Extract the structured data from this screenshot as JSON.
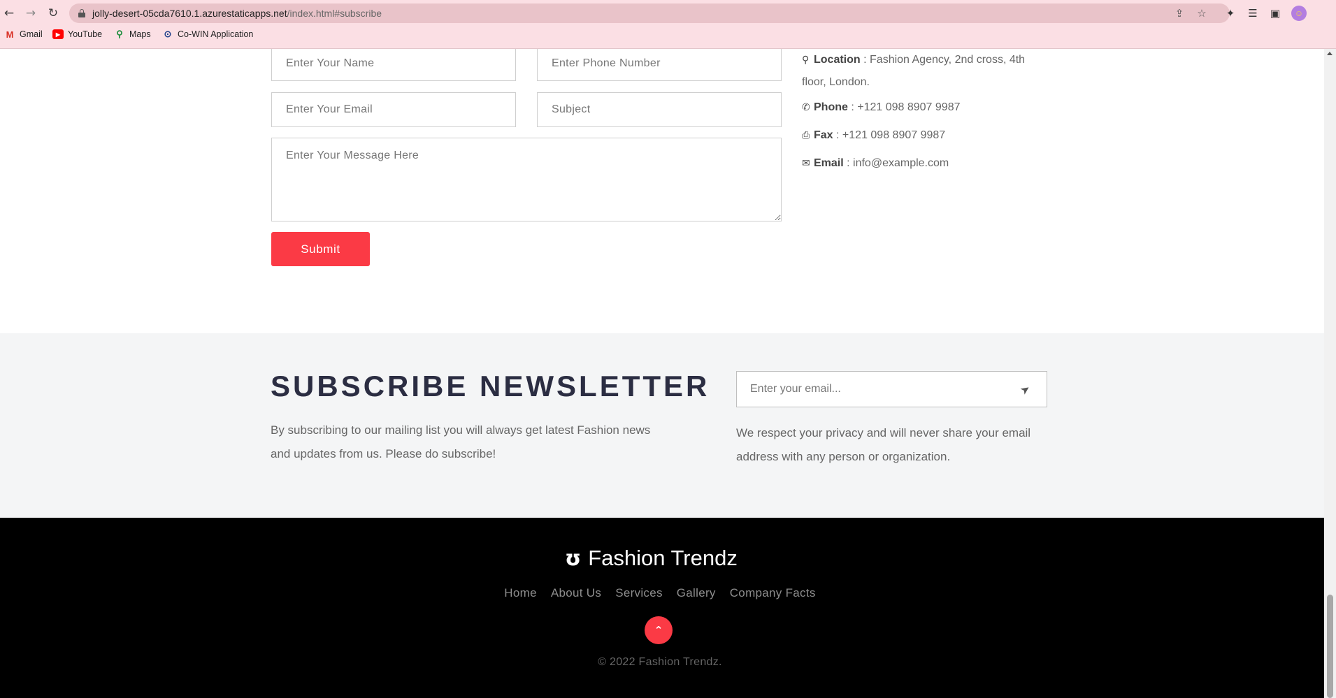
{
  "browser": {
    "url_host": "jolly-desert-05cda7610.1.azurestaticapps.net",
    "url_path": "/index.html#subscribe",
    "bookmarks": [
      {
        "label": "Gmail",
        "icon": "gmail-icon"
      },
      {
        "label": "YouTube",
        "icon": "youtube-icon"
      },
      {
        "label": "Maps",
        "icon": "maps-icon"
      },
      {
        "label": "Co-WIN Application",
        "icon": "cowin-icon"
      }
    ]
  },
  "contact_form": {
    "name_placeholder": "Enter Your Name",
    "phone_placeholder": "Enter Phone Number",
    "email_placeholder": "Enter Your Email",
    "subject_placeholder": "Subject",
    "message_placeholder": "Enter Your Message Here",
    "submit_label": "Submit"
  },
  "contact_info": {
    "location_label": "Location",
    "location_value": "Fashion Agency, 2nd cross, 4th floor, London.",
    "phone_label": "Phone",
    "phone_value": "+121 098 8907 9987",
    "fax_label": "Fax",
    "fax_value": "+121 098 8907 9987",
    "email_label": "Email",
    "email_value": "info@example.com"
  },
  "newsletter": {
    "title": "SUBSCRIBE NEWSLETTER",
    "description": "By subscribing to our mailing list you will always get latest Fashion news and updates from us. Please do subscribe!",
    "email_placeholder": "Enter your email...",
    "privacy_note": "We respect your privacy and will never share your email address with any person or organization."
  },
  "footer": {
    "brand": "Fashion Trendz",
    "nav": [
      "Home",
      "About Us",
      "Services",
      "Gallery",
      "Company Facts"
    ],
    "copyright": "© 2022 Fashion Trendz."
  },
  "colors": {
    "accent": "#fb3a45",
    "chrome": "#fbdfe4",
    "newsletter_bg": "#f4f5f6",
    "footer_bg": "#000000"
  }
}
